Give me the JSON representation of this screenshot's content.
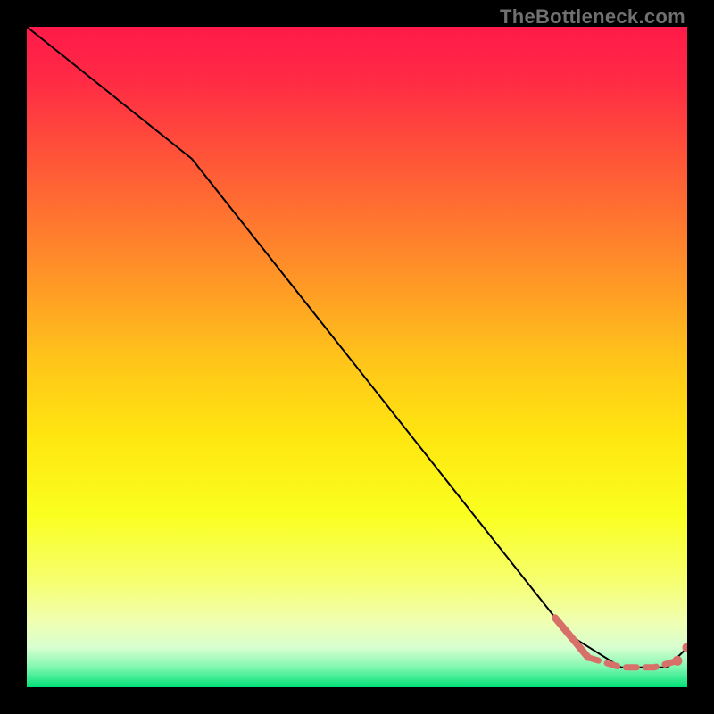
{
  "attribution": "TheBottleneck.com",
  "colors": {
    "background": "#000000",
    "gradient_stops": [
      {
        "offset": 0.0,
        "color": "#ff1a49"
      },
      {
        "offset": 0.08,
        "color": "#ff2a45"
      },
      {
        "offset": 0.2,
        "color": "#ff5538"
      },
      {
        "offset": 0.35,
        "color": "#ff8a2a"
      },
      {
        "offset": 0.5,
        "color": "#ffc31a"
      },
      {
        "offset": 0.62,
        "color": "#ffe610"
      },
      {
        "offset": 0.74,
        "color": "#faff20"
      },
      {
        "offset": 0.84,
        "color": "#f6ff70"
      },
      {
        "offset": 0.9,
        "color": "#f0ffb0"
      },
      {
        "offset": 0.94,
        "color": "#d8ffd0"
      },
      {
        "offset": 0.97,
        "color": "#80f7b0"
      },
      {
        "offset": 1.0,
        "color": "#00e178"
      }
    ],
    "main_line": "#000000",
    "highlight": "#d8706a",
    "marker_fill": "#d8706a"
  },
  "chart_data": {
    "type": "line",
    "title": "",
    "xlabel": "",
    "ylabel": "",
    "xlim": [
      0,
      100
    ],
    "ylim": [
      0,
      100
    ],
    "series": [
      {
        "name": "bottleneck-curve",
        "style": "solid-thin",
        "x": [
          0,
          25,
          82,
          90,
          97,
          100
        ],
        "y": [
          100,
          80,
          8,
          3,
          3,
          6
        ]
      },
      {
        "name": "highlight-segment-solid",
        "style": "solid-thick",
        "x": [
          80,
          85
        ],
        "y": [
          10.5,
          4.5
        ]
      },
      {
        "name": "highlight-segment-dashed",
        "style": "dashed-thick",
        "x": [
          85,
          90,
          95,
          98.5
        ],
        "y": [
          4.5,
          3.0,
          3.0,
          4.0
        ]
      }
    ],
    "markers": [
      {
        "x": 98.5,
        "y": 4.0
      },
      {
        "x": 100.0,
        "y": 6.0
      }
    ]
  }
}
